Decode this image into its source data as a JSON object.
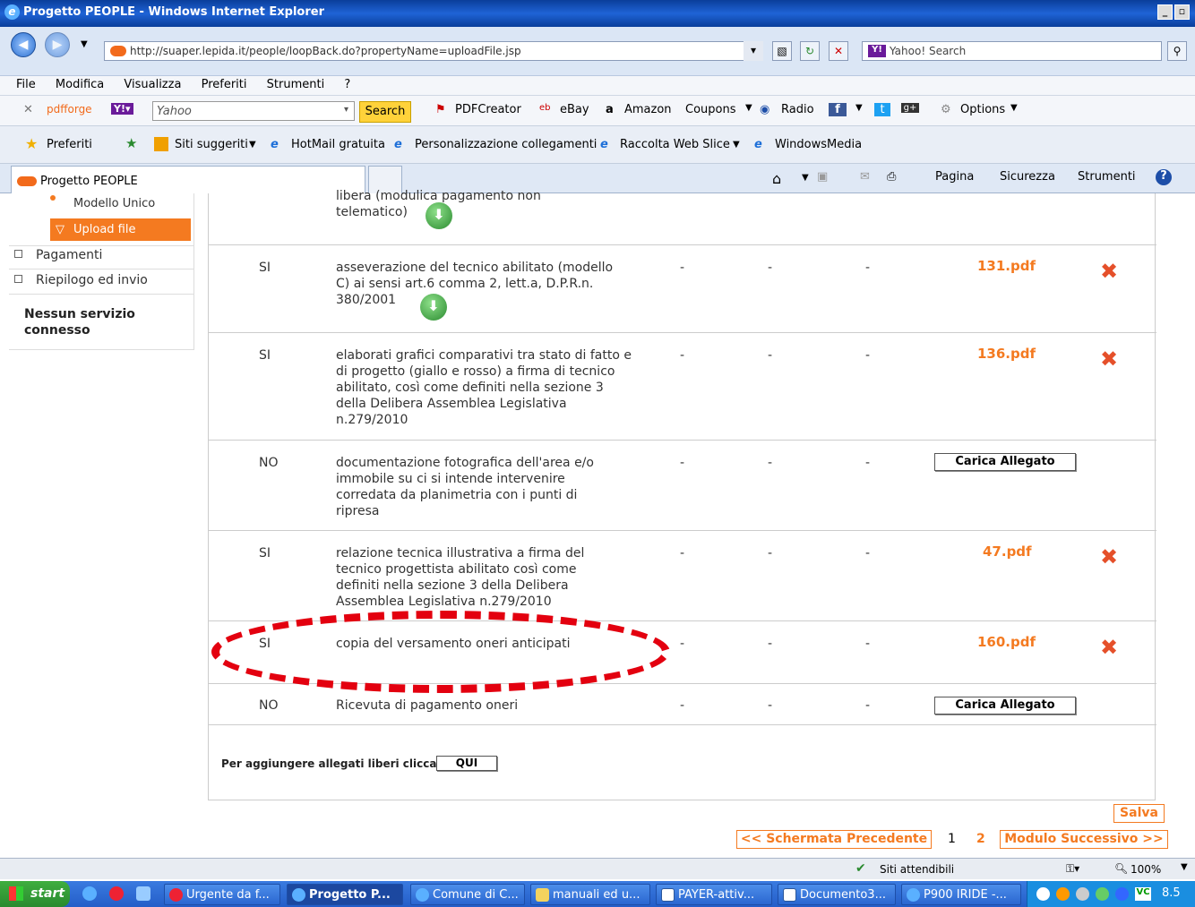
{
  "window": {
    "title": "Progetto PEOPLE - Windows Internet Explorer",
    "min": "_",
    "max": "8",
    "close": "x"
  },
  "address": {
    "url": "http://suaper.lepida.it/people/loopBack.do?propertyName=uploadFile.jsp",
    "search_placeholder": "Yahoo! Search"
  },
  "menu": [
    "File",
    "Modifica",
    "Visualizza",
    "Preferiti",
    "Strumenti",
    "?"
  ],
  "toolbar": {
    "pdfforge": "pdfforge",
    "yahoo_field": "Yahoo",
    "search_btn": "Search",
    "pdfcreator": "PDFCreator",
    "ebay": "eBay",
    "amazon": "Amazon",
    "coupons": "Coupons",
    "radio": "Radio",
    "options": "Options"
  },
  "favorites": {
    "preferiti": "Preferiti",
    "items": [
      "Siti suggeriti",
      "HotMail gratuita",
      "Personalizzazione collegamenti",
      "Raccolta Web Slice",
      "WindowsMedia"
    ]
  },
  "tabs": {
    "active": "Progetto PEOPLE",
    "cmd": [
      "Pagina",
      "Sicurezza",
      "Strumenti"
    ]
  },
  "sidebar": {
    "modello_unico": "Modello Unico",
    "upload_file": "Upload file",
    "pagamenti": "Pagamenti",
    "riepilogo": "Riepilogo ed invio",
    "nessun": "Nessun servizio connesso"
  },
  "rows": [
    {
      "req": "",
      "desc": "libera (modulica pagamento non telematico)",
      "file": ""
    },
    {
      "req": "SI",
      "desc": "asseverazione del tecnico abilitato (modello C) ai sensi art.6 comma 2, lett.a, D.P.R.n. 380/2001",
      "file": "131.pdf"
    },
    {
      "req": "SI",
      "desc": "elaborati grafici comparativi tra stato di fatto e di progetto (giallo e rosso) a firma di tecnico abilitato, così come definiti nella sezione 3 della Delibera Assemblea Legislativa n.279/2010",
      "file": "136.pdf"
    },
    {
      "req": "NO",
      "desc": "documentazione fotografica dell'area e/o immobile su ci si intende intervenire corredata da planimetria con i punti di ripresa",
      "file": ""
    },
    {
      "req": "SI",
      "desc": "relazione tecnica illustrativa a firma del tecnico progettista abilitato così come definiti nella sezione 3 della Delibera Assemblea Legislativa n.279/2010",
      "file": "47.pdf"
    },
    {
      "req": "SI",
      "desc": "copia del versamento oneri anticipati",
      "file": "160.pdf"
    },
    {
      "req": "NO",
      "desc": "Ricevuta di pagamento oneri",
      "file": ""
    }
  ],
  "dash": "-",
  "carica": "Carica Allegato",
  "allegati_liberi": "Per aggiungere allegati liberi clicca",
  "qui": "QUI",
  "salva": "Salva",
  "nav": {
    "prev": "<< Schermata Precedente",
    "page1": "1",
    "page2": "2",
    "next": "Modulo Successivo >>"
  },
  "status": {
    "zone": "Siti attendibili",
    "zoom": "100%"
  },
  "taskbar": {
    "start": "start",
    "items": [
      "Urgente da f...",
      "Progetto P...",
      "Comune di C...",
      "manuali ed u...",
      "PAYER-attiv...",
      "Documento3...",
      "P900 IRIDE -..."
    ],
    "clock": "8.5"
  }
}
